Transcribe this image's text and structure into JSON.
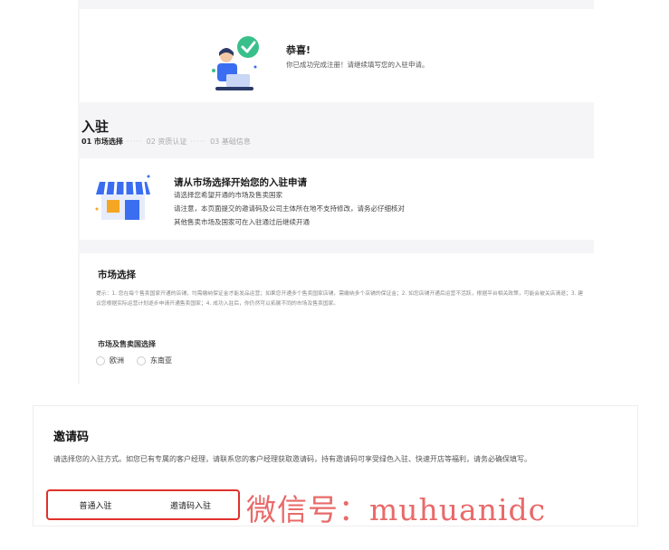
{
  "success": {
    "title": "恭喜!",
    "desc": "你已成功完成注册！请继续填写您的入驻申请。"
  },
  "ruzhu": {
    "title": "入驻",
    "steps": [
      "01 市场选择",
      "02 资质认证",
      "03 基础信息"
    ],
    "dots": "·····"
  },
  "market_intro": {
    "title": "请从市场选择开始您的入驻申请",
    "lines": [
      "请选择您希望开通的市场及售卖国家",
      "请注意，本页面提交的邀请码及公司主体所在地不支持修改，请务必仔细核对",
      "其他售卖市场及国家可在入驻通过后继续开通"
    ]
  },
  "market_select": {
    "title": "市场选择",
    "tip": "提示：1. 您在每个售卖国家开通的店铺，均需缴纳保证金才能发品运营；如果您开通多个售卖国家店铺，需缴纳多个店铺的保证金；2. 如您店铺开通后运营不活跃，根据平台相关政策，可能会被关店清退；3. 建议您根据实际运营计划逐步申请开通售卖国家；4. 成功入驻后，你仍然可以拓展不同的市场及售卖国家。",
    "sub_title": "市场及售卖国选择",
    "options": [
      "欧洲",
      "东南亚"
    ]
  },
  "invite": {
    "title": "邀请码",
    "desc": "请选择您的入驻方式。如您已有专属的客户经理，请联系您的客户经理获取邀请码，持有邀请码可享受绿色入驻、快速开店等福利，请务必确保填写。",
    "buttons": [
      "普通入驻",
      "邀请码入驻"
    ]
  },
  "watermark": "微信号：muhuanidc",
  "colors": {
    "page_bg": "#f5f5f7",
    "highlight_border": "#e0312b",
    "watermark": "#e96a6a",
    "illu_blue": "#3a6df0",
    "illu_green": "#39c08a"
  }
}
